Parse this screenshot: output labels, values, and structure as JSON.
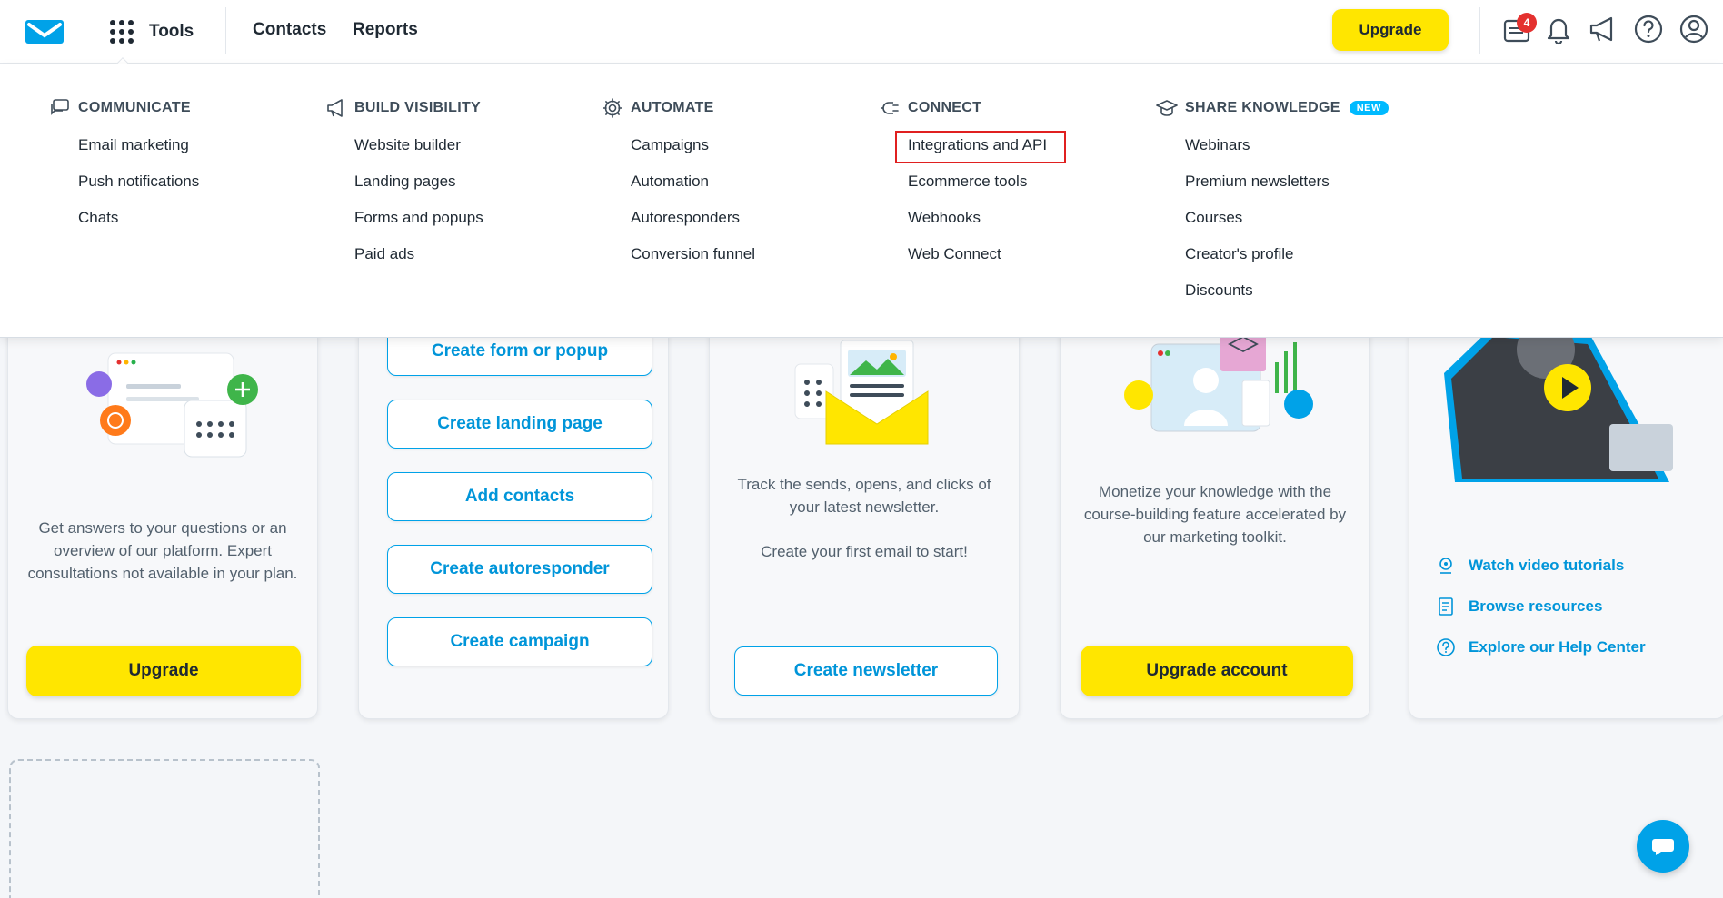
{
  "nav": {
    "tools_label": "Tools",
    "contacts_label": "Contacts",
    "reports_label": "Reports",
    "upgrade_label": "Upgrade",
    "notification_count": "4"
  },
  "menu": {
    "communicate": {
      "title": "COMMUNICATE",
      "items": [
        "Email marketing",
        "Push notifications",
        "Chats"
      ]
    },
    "build_visibility": {
      "title": "BUILD VISIBILITY",
      "items": [
        "Website builder",
        "Landing pages",
        "Forms and popups",
        "Paid ads"
      ]
    },
    "automate": {
      "title": "AUTOMATE",
      "items": [
        "Campaigns",
        "Automation",
        "Autoresponders",
        "Conversion funnel"
      ]
    },
    "connect": {
      "title": "CONNECT",
      "items": [
        "Integrations and API",
        "Ecommerce tools",
        "Webhooks",
        "Web Connect"
      ]
    },
    "share_knowledge": {
      "title": "SHARE KNOWLEDGE",
      "badge": "NEW",
      "items": [
        "Webinars",
        "Premium newsletters",
        "Courses",
        "Creator's profile",
        "Discounts"
      ]
    }
  },
  "cards": {
    "support": {
      "text": "Get answers to your questions or an overview of our platform. Expert consultations not available in your plan.",
      "button": "Upgrade"
    },
    "quick_actions": {
      "buttons": [
        "Create form or popup",
        "Create landing page",
        "Add contacts",
        "Create autoresponder",
        "Create campaign"
      ]
    },
    "newsletter": {
      "text1": "Track the sends, opens, and clicks of your latest newsletter.",
      "text2": "Create your first email to start!",
      "button": "Create newsletter"
    },
    "courses": {
      "text": "Monetize your knowledge with the course-building feature accelerated by our marketing toolkit.",
      "button": "Upgrade account"
    },
    "help": {
      "links": [
        "Watch video tutorials",
        "Browse resources",
        "Explore our Help Center"
      ]
    }
  },
  "colors": {
    "accent": "#00a2e8",
    "cta": "#ffe600",
    "highlight": "#e02020"
  }
}
